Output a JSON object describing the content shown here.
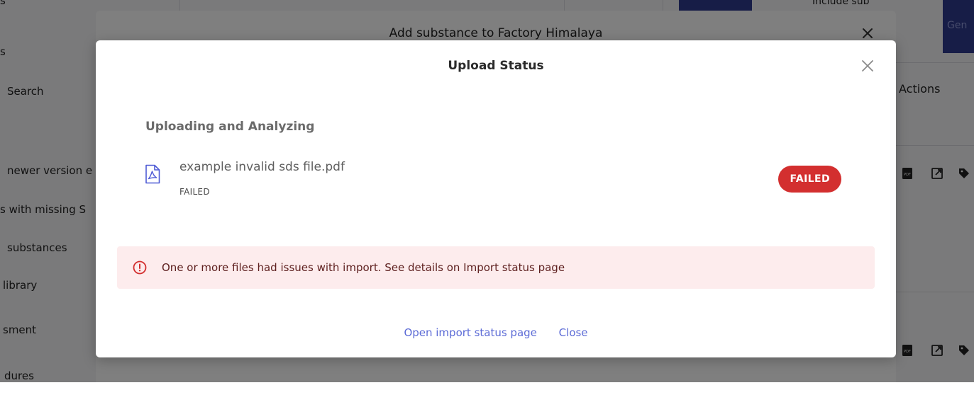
{
  "background": {
    "sidebar_items": [
      "s",
      "s",
      "Search",
      "newer version e",
      "s with missing S",
      "substances",
      "library",
      "sment",
      "dures"
    ],
    "include_sub_label": "Include sub",
    "gen_button_label": "Gen",
    "actions_header": "Actions"
  },
  "underlying_dialog": {
    "title": "Add substance to Factory Himalaya",
    "close_icon": "close-icon"
  },
  "modal": {
    "title": "Upload Status",
    "close_icon": "close-icon",
    "section_heading": "Uploading and Analyzing",
    "files": [
      {
        "name": "example invalid sds file.pdf",
        "status": "FAILED",
        "badge": "FAILED",
        "icon": "pdf-file-icon"
      }
    ],
    "alert": {
      "icon": "error-circle-icon",
      "message": "One or more files had issues with import. See details on Import status page"
    },
    "footer": {
      "open_import_label": "Open import status page",
      "close_label": "Close"
    }
  },
  "colors": {
    "badge_failed": "#d32f2f",
    "alert_background": "#fdeced",
    "alert_icon": "#d32f2f",
    "link": "#5c6bd6",
    "pdf_icon": "#4f5bd5",
    "brand_button": "#2f3a8f"
  }
}
